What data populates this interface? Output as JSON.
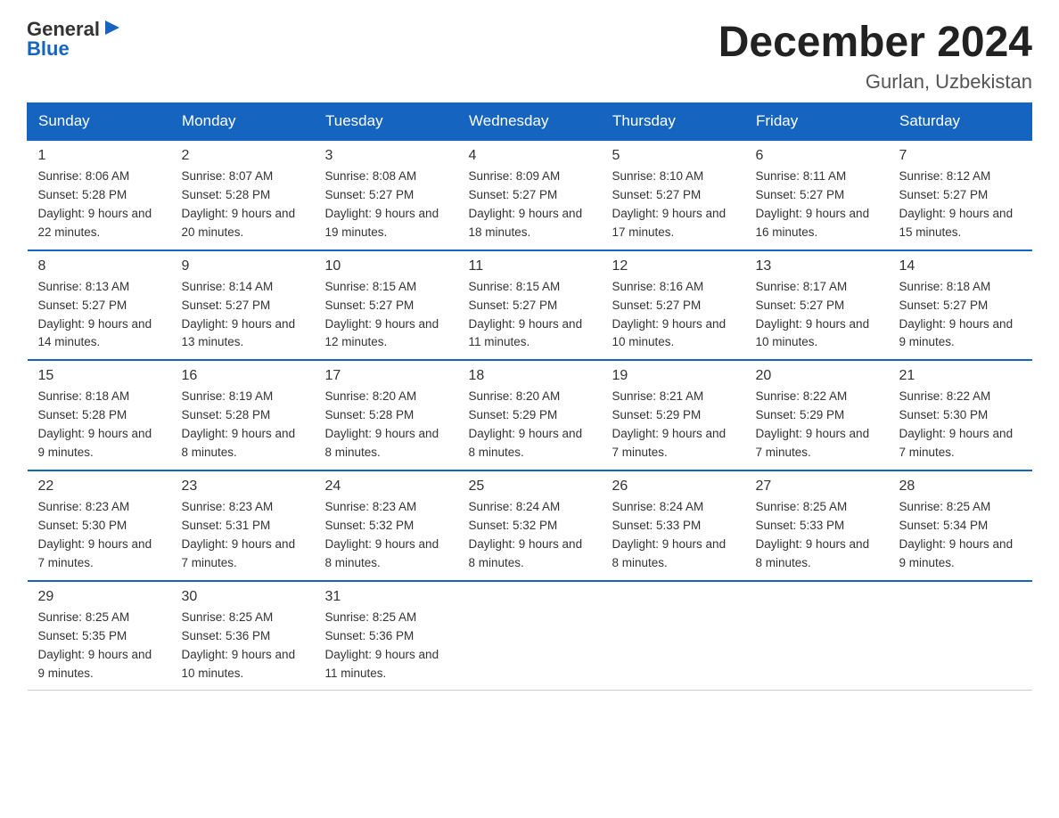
{
  "header": {
    "logo_text_general": "General",
    "logo_text_blue": "Blue",
    "title": "December 2024",
    "location": "Gurlan, Uzbekistan"
  },
  "days_of_week": [
    "Sunday",
    "Monday",
    "Tuesday",
    "Wednesday",
    "Thursday",
    "Friday",
    "Saturday"
  ],
  "weeks": [
    [
      {
        "day": "1",
        "sunrise": "8:06 AM",
        "sunset": "5:28 PM",
        "daylight": "9 hours and 22 minutes."
      },
      {
        "day": "2",
        "sunrise": "8:07 AM",
        "sunset": "5:28 PM",
        "daylight": "9 hours and 20 minutes."
      },
      {
        "day": "3",
        "sunrise": "8:08 AM",
        "sunset": "5:27 PM",
        "daylight": "9 hours and 19 minutes."
      },
      {
        "day": "4",
        "sunrise": "8:09 AM",
        "sunset": "5:27 PM",
        "daylight": "9 hours and 18 minutes."
      },
      {
        "day": "5",
        "sunrise": "8:10 AM",
        "sunset": "5:27 PM",
        "daylight": "9 hours and 17 minutes."
      },
      {
        "day": "6",
        "sunrise": "8:11 AM",
        "sunset": "5:27 PM",
        "daylight": "9 hours and 16 minutes."
      },
      {
        "day": "7",
        "sunrise": "8:12 AM",
        "sunset": "5:27 PM",
        "daylight": "9 hours and 15 minutes."
      }
    ],
    [
      {
        "day": "8",
        "sunrise": "8:13 AM",
        "sunset": "5:27 PM",
        "daylight": "9 hours and 14 minutes."
      },
      {
        "day": "9",
        "sunrise": "8:14 AM",
        "sunset": "5:27 PM",
        "daylight": "9 hours and 13 minutes."
      },
      {
        "day": "10",
        "sunrise": "8:15 AM",
        "sunset": "5:27 PM",
        "daylight": "9 hours and 12 minutes."
      },
      {
        "day": "11",
        "sunrise": "8:15 AM",
        "sunset": "5:27 PM",
        "daylight": "9 hours and 11 minutes."
      },
      {
        "day": "12",
        "sunrise": "8:16 AM",
        "sunset": "5:27 PM",
        "daylight": "9 hours and 10 minutes."
      },
      {
        "day": "13",
        "sunrise": "8:17 AM",
        "sunset": "5:27 PM",
        "daylight": "9 hours and 10 minutes."
      },
      {
        "day": "14",
        "sunrise": "8:18 AM",
        "sunset": "5:27 PM",
        "daylight": "9 hours and 9 minutes."
      }
    ],
    [
      {
        "day": "15",
        "sunrise": "8:18 AM",
        "sunset": "5:28 PM",
        "daylight": "9 hours and 9 minutes."
      },
      {
        "day": "16",
        "sunrise": "8:19 AM",
        "sunset": "5:28 PM",
        "daylight": "9 hours and 8 minutes."
      },
      {
        "day": "17",
        "sunrise": "8:20 AM",
        "sunset": "5:28 PM",
        "daylight": "9 hours and 8 minutes."
      },
      {
        "day": "18",
        "sunrise": "8:20 AM",
        "sunset": "5:29 PM",
        "daylight": "9 hours and 8 minutes."
      },
      {
        "day": "19",
        "sunrise": "8:21 AM",
        "sunset": "5:29 PM",
        "daylight": "9 hours and 7 minutes."
      },
      {
        "day": "20",
        "sunrise": "8:22 AM",
        "sunset": "5:29 PM",
        "daylight": "9 hours and 7 minutes."
      },
      {
        "day": "21",
        "sunrise": "8:22 AM",
        "sunset": "5:30 PM",
        "daylight": "9 hours and 7 minutes."
      }
    ],
    [
      {
        "day": "22",
        "sunrise": "8:23 AM",
        "sunset": "5:30 PM",
        "daylight": "9 hours and 7 minutes."
      },
      {
        "day": "23",
        "sunrise": "8:23 AM",
        "sunset": "5:31 PM",
        "daylight": "9 hours and 7 minutes."
      },
      {
        "day": "24",
        "sunrise": "8:23 AM",
        "sunset": "5:32 PM",
        "daylight": "9 hours and 8 minutes."
      },
      {
        "day": "25",
        "sunrise": "8:24 AM",
        "sunset": "5:32 PM",
        "daylight": "9 hours and 8 minutes."
      },
      {
        "day": "26",
        "sunrise": "8:24 AM",
        "sunset": "5:33 PM",
        "daylight": "9 hours and 8 minutes."
      },
      {
        "day": "27",
        "sunrise": "8:25 AM",
        "sunset": "5:33 PM",
        "daylight": "9 hours and 8 minutes."
      },
      {
        "day": "28",
        "sunrise": "8:25 AM",
        "sunset": "5:34 PM",
        "daylight": "9 hours and 9 minutes."
      }
    ],
    [
      {
        "day": "29",
        "sunrise": "8:25 AM",
        "sunset": "5:35 PM",
        "daylight": "9 hours and 9 minutes."
      },
      {
        "day": "30",
        "sunrise": "8:25 AM",
        "sunset": "5:36 PM",
        "daylight": "9 hours and 10 minutes."
      },
      {
        "day": "31",
        "sunrise": "8:25 AM",
        "sunset": "5:36 PM",
        "daylight": "9 hours and 11 minutes."
      },
      null,
      null,
      null,
      null
    ]
  ]
}
